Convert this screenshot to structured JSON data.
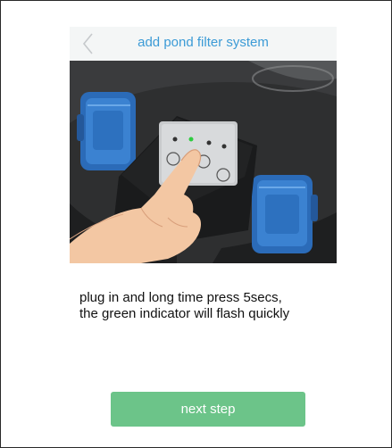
{
  "header": {
    "back_icon": "chevron-left-icon",
    "title": "add pond filter system"
  },
  "photo": {
    "subject": "hand pressing button on pond filter control box with two blue sockets"
  },
  "instruction": {
    "line1": "plug in and long time press 5secs,",
    "line2": "the green indicator will flash quickly"
  },
  "footer": {
    "next_label": "next step"
  },
  "colors": {
    "title": "#3c9bd6",
    "button": "#6cc489",
    "header_bg": "#f4f6f6",
    "indicator": "#2ecc40"
  }
}
